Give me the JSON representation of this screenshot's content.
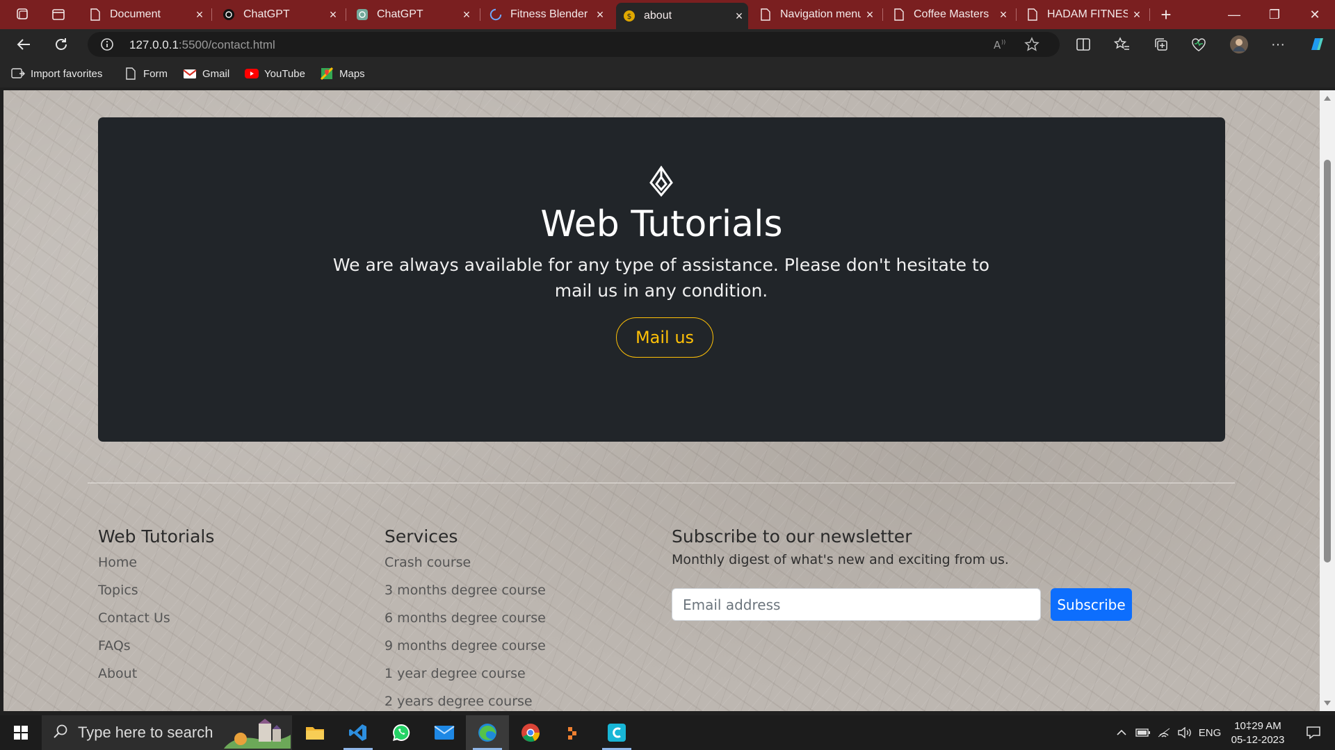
{
  "browser": {
    "tabs": [
      {
        "title": "Document",
        "icon": "page-icon"
      },
      {
        "title": "ChatGPT",
        "icon": "chatgpt-icon"
      },
      {
        "title": "ChatGPT",
        "icon": "chatgpt-icon"
      },
      {
        "title": "Fitness Blender",
        "icon": "loading-icon"
      },
      {
        "title": "about",
        "icon": "dollar-icon",
        "active": true
      },
      {
        "title": "Navigation menu",
        "icon": "page-icon"
      },
      {
        "title": "Coffee Masters",
        "icon": "page-icon"
      },
      {
        "title": "HADAM FITNESS",
        "icon": "page-icon"
      }
    ],
    "url": {
      "host": "127.0.0.1",
      "path": ":5500/contact.html"
    },
    "favorites": [
      {
        "label": "Import favorites",
        "icon": "import-icon"
      },
      {
        "label": "Form",
        "icon": "page-icon"
      },
      {
        "label": "Gmail",
        "icon": "gmail-icon"
      },
      {
        "label": "YouTube",
        "icon": "youtube-icon"
      },
      {
        "label": "Maps",
        "icon": "maps-icon"
      }
    ],
    "accent_color": "#7a1f20"
  },
  "page": {
    "hero": {
      "title": "Web Tutorials",
      "text": "We are always available for any type of assistance. Please don't hesitate to mail us in any condition.",
      "button": "Mail us",
      "button_color": "#ffc107"
    },
    "footer": {
      "col1": {
        "heading": "Web Tutorials",
        "links": [
          "Home",
          "Topics",
          "Contact Us",
          "FAQs",
          "About"
        ]
      },
      "col2": {
        "heading": "Services",
        "links": [
          "Crash course",
          "3 months degree course",
          "6 months degree course",
          "9 months degree course",
          "1 year degree course",
          "2 years degree course"
        ]
      },
      "newsletter": {
        "heading": "Subscribe to our newsletter",
        "description": "Monthly digest of what's new and exciting from us.",
        "email_placeholder": "Email address",
        "button": "Subscribe",
        "button_color": "#0d6efd"
      }
    }
  },
  "taskbar": {
    "search_placeholder": "Type here to search",
    "apps": [
      "file-explorer-icon",
      "vscode-icon",
      "whatsapp-icon",
      "mail-icon",
      "edge-icon",
      "chrome-icon",
      "app-icon",
      "canva-icon"
    ],
    "language": "ENG",
    "time": "10‡29 AM",
    "date": "05-12-2023"
  }
}
